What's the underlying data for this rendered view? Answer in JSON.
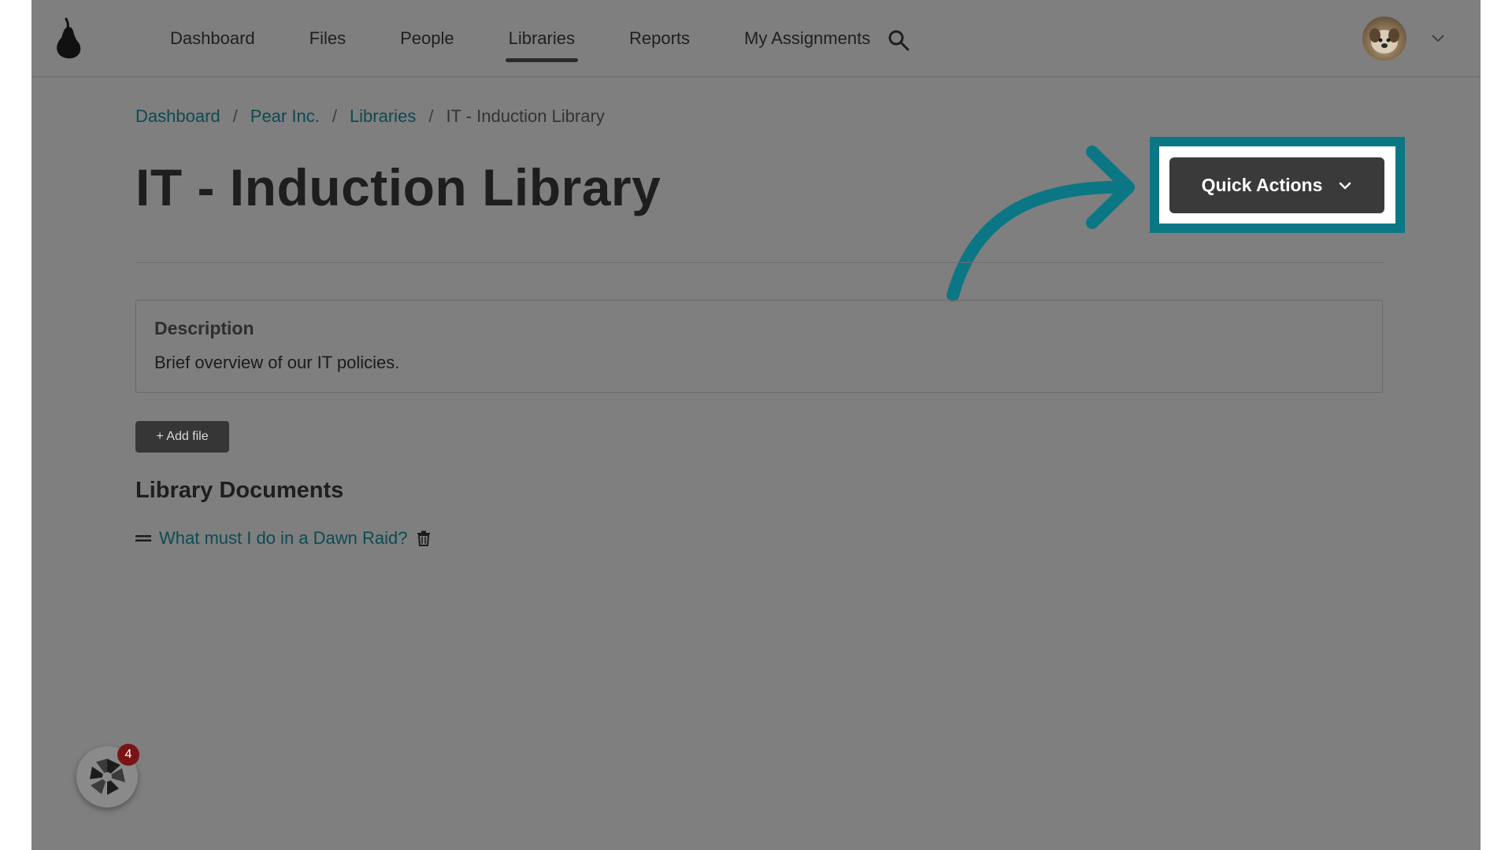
{
  "nav": {
    "items": [
      {
        "label": "Dashboard"
      },
      {
        "label": "Files"
      },
      {
        "label": "People"
      },
      {
        "label": "Libraries"
      },
      {
        "label": "Reports"
      },
      {
        "label": "My Assignments"
      }
    ],
    "active": "Libraries",
    "search_icon": "search-icon",
    "avatar_icon": "user-avatar",
    "menu_icon": "chevron-down-icon"
  },
  "breadcrumb": {
    "items": [
      {
        "label": "Dashboard"
      },
      {
        "label": "Pear Inc."
      },
      {
        "label": "Libraries"
      }
    ],
    "separator": "/",
    "current": "IT - Induction Library"
  },
  "page": {
    "title": "IT - Induction Library",
    "quick_actions_label": "Quick Actions"
  },
  "description": {
    "heading": "Description",
    "text": "Brief overview of our IT policies."
  },
  "toolbar": {
    "add_file_label": "+ Add file"
  },
  "documents": {
    "heading": "Library Documents",
    "items": [
      {
        "title": "What must I do in a Dawn Raid?"
      }
    ]
  },
  "widget": {
    "badge_count": "4"
  },
  "colors": {
    "accent": "#0b7785",
    "link": "#0d4a52",
    "overlay": "#7f7f7f",
    "button_dark": "#3a3a3a",
    "badge": "#7a1414"
  }
}
